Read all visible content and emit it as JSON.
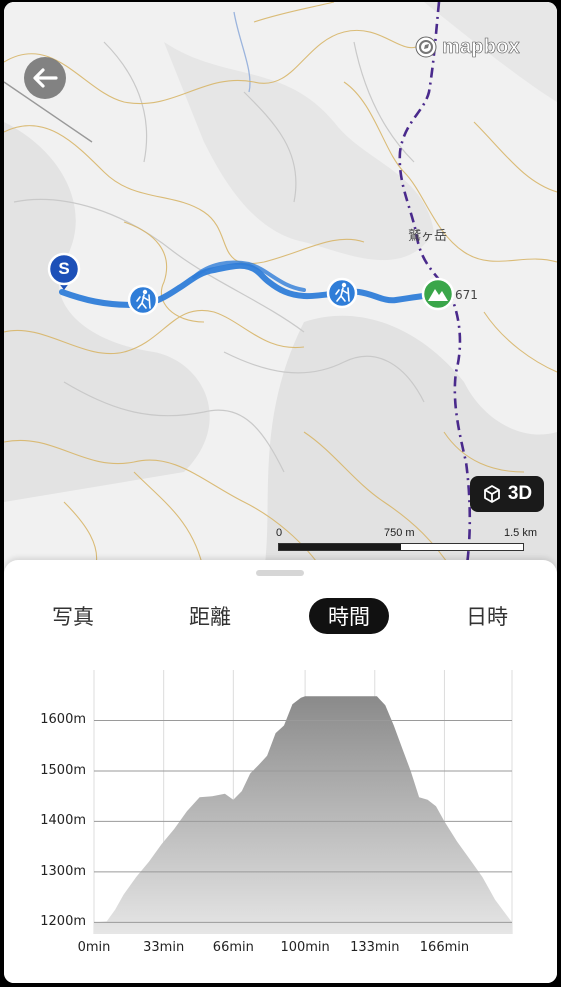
{
  "map": {
    "attribution": "mapbox",
    "peak_name": "鷲ヶ岳",
    "peak_elevation": "671",
    "start_marker": "S",
    "view_3d_label": "3D",
    "scale": {
      "start": "0",
      "mid": "750 m",
      "end": "1.5 km"
    }
  },
  "tabs": [
    {
      "label": "写真",
      "active": false
    },
    {
      "label": "距離",
      "active": false
    },
    {
      "label": "時間",
      "active": true
    },
    {
      "label": "日時",
      "active": false
    }
  ],
  "chart_data": {
    "type": "area",
    "xlabel": "",
    "ylabel": "",
    "x_tick_labels": [
      "0min",
      "33min",
      "66min",
      "100min",
      "133min",
      "166min"
    ],
    "x_ticks": [
      0,
      33,
      66,
      100,
      133,
      166
    ],
    "y_tick_labels": [
      "1200m",
      "1300m",
      "1400m",
      "1500m",
      "1600m"
    ],
    "y_ticks": [
      1200,
      1300,
      1400,
      1500,
      1600
    ],
    "xlim": [
      0,
      198
    ],
    "ylim": [
      1177,
      1700
    ],
    "grid": true,
    "color": "#888888",
    "x": [
      0,
      6,
      10,
      14,
      20,
      26,
      32,
      38,
      44,
      50,
      56,
      62,
      66,
      70,
      74,
      78,
      82,
      86,
      90,
      94,
      98,
      100,
      104,
      110,
      116,
      122,
      128,
      134,
      138,
      142,
      146,
      150,
      154,
      158,
      162,
      166,
      172,
      178,
      184,
      190,
      198
    ],
    "y": [
      1200,
      1202,
      1225,
      1255,
      1290,
      1320,
      1355,
      1385,
      1420,
      1448,
      1450,
      1455,
      1443,
      1460,
      1495,
      1512,
      1530,
      1575,
      1590,
      1632,
      1645,
      1648,
      1648,
      1648,
      1648,
      1648,
      1648,
      1648,
      1630,
      1590,
      1545,
      1500,
      1448,
      1443,
      1430,
      1400,
      1360,
      1325,
      1290,
      1245,
      1200
    ]
  }
}
